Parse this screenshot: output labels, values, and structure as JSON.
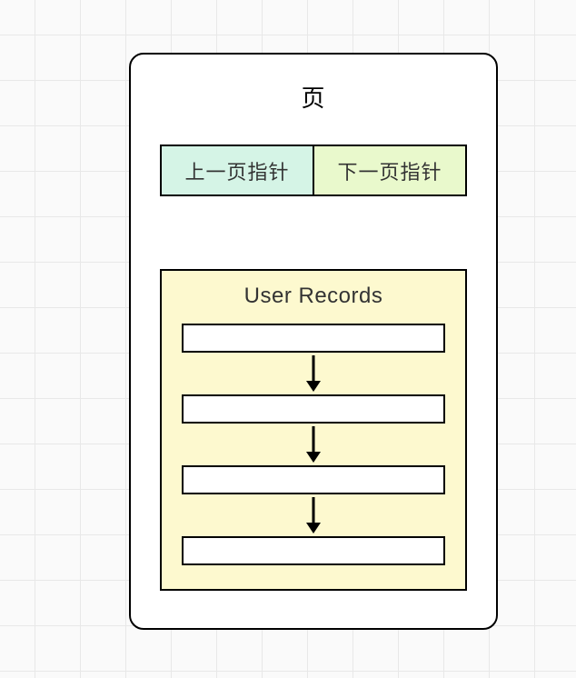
{
  "page": {
    "title": "页",
    "pointers": {
      "prev": "上一页指针",
      "next": "下一页指针"
    },
    "records": {
      "title": "User Records",
      "slot_count": 4
    }
  }
}
